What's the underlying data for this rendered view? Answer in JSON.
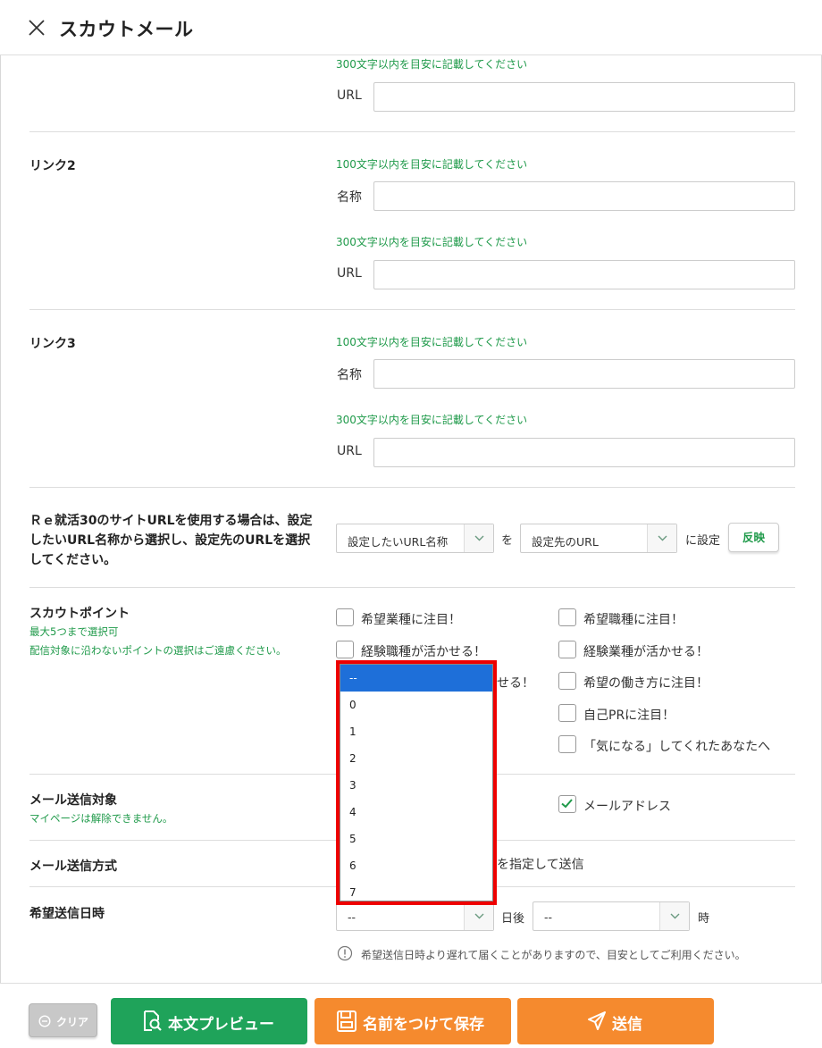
{
  "header": {
    "title": "スカウトメール"
  },
  "link1": {
    "url_hint": "300文字以内を目安に記載してください",
    "url_label": "URL"
  },
  "link2": {
    "label": "リンク2",
    "name_hint": "100文字以内を目安に記載してください",
    "name_label": "名称",
    "url_hint": "300文字以内を目安に記載してください",
    "url_label": "URL"
  },
  "link3": {
    "label": "リンク3",
    "name_hint": "100文字以内を目安に記載してください",
    "name_label": "名称",
    "url_hint": "300文字以内を目安に記載してください",
    "url_label": "URL"
  },
  "site_url": {
    "label_lines": [
      "Ｒｅ就活30のサイトURLを使用する場合は、設定",
      "したいURL名称から選択し、設定先のURLを選択",
      "してください。"
    ],
    "select1": "設定したいURL名称",
    "wo": "を",
    "select2": "設定先のURL",
    "set_text": "に設定",
    "reflect_button": "反映"
  },
  "scout_point": {
    "label": "スカウトポイント",
    "note1": "最大5つまで選択可",
    "note2": "配信対象に沿わないポイントの選択はご遠慮ください。",
    "options": [
      "希望業種に注目！",
      "希望職種に注目！",
      "経験職種が活かせる！",
      "経験業種が活かせる！",
      "せる！",
      "希望の働き方に注目！",
      "自己PRに注目！",
      "「気になる」してくれたあなたへ"
    ]
  },
  "mail_target": {
    "label": "メール送信対象",
    "note": "マイページは解除できません。",
    "option": "メールアドレス"
  },
  "mail_method": {
    "label": "メール送信方式",
    "partial": "を指定して送信"
  },
  "send_datetime": {
    "label": "希望送信日時",
    "day_select": "--",
    "day_suffix": "日後",
    "hour_select": "--",
    "hour_suffix": "時",
    "info": "希望送信日時より遅れて届くことがありますので、目安としてご利用ください。"
  },
  "dropdown": {
    "options": [
      "--",
      "0",
      "1",
      "2",
      "3",
      "4",
      "5",
      "6",
      "7"
    ],
    "selected": "--"
  },
  "footer": {
    "clear": "クリア",
    "preview": "本文プレビュー",
    "save": "名前をつけて保存",
    "send": "送信"
  },
  "colors": {
    "green": "#1f9a4a",
    "button_green": "#1fa35a",
    "button_orange": "#f58a2e",
    "highlight_red": "#e00000",
    "select_blue": "#1e6fd9"
  }
}
